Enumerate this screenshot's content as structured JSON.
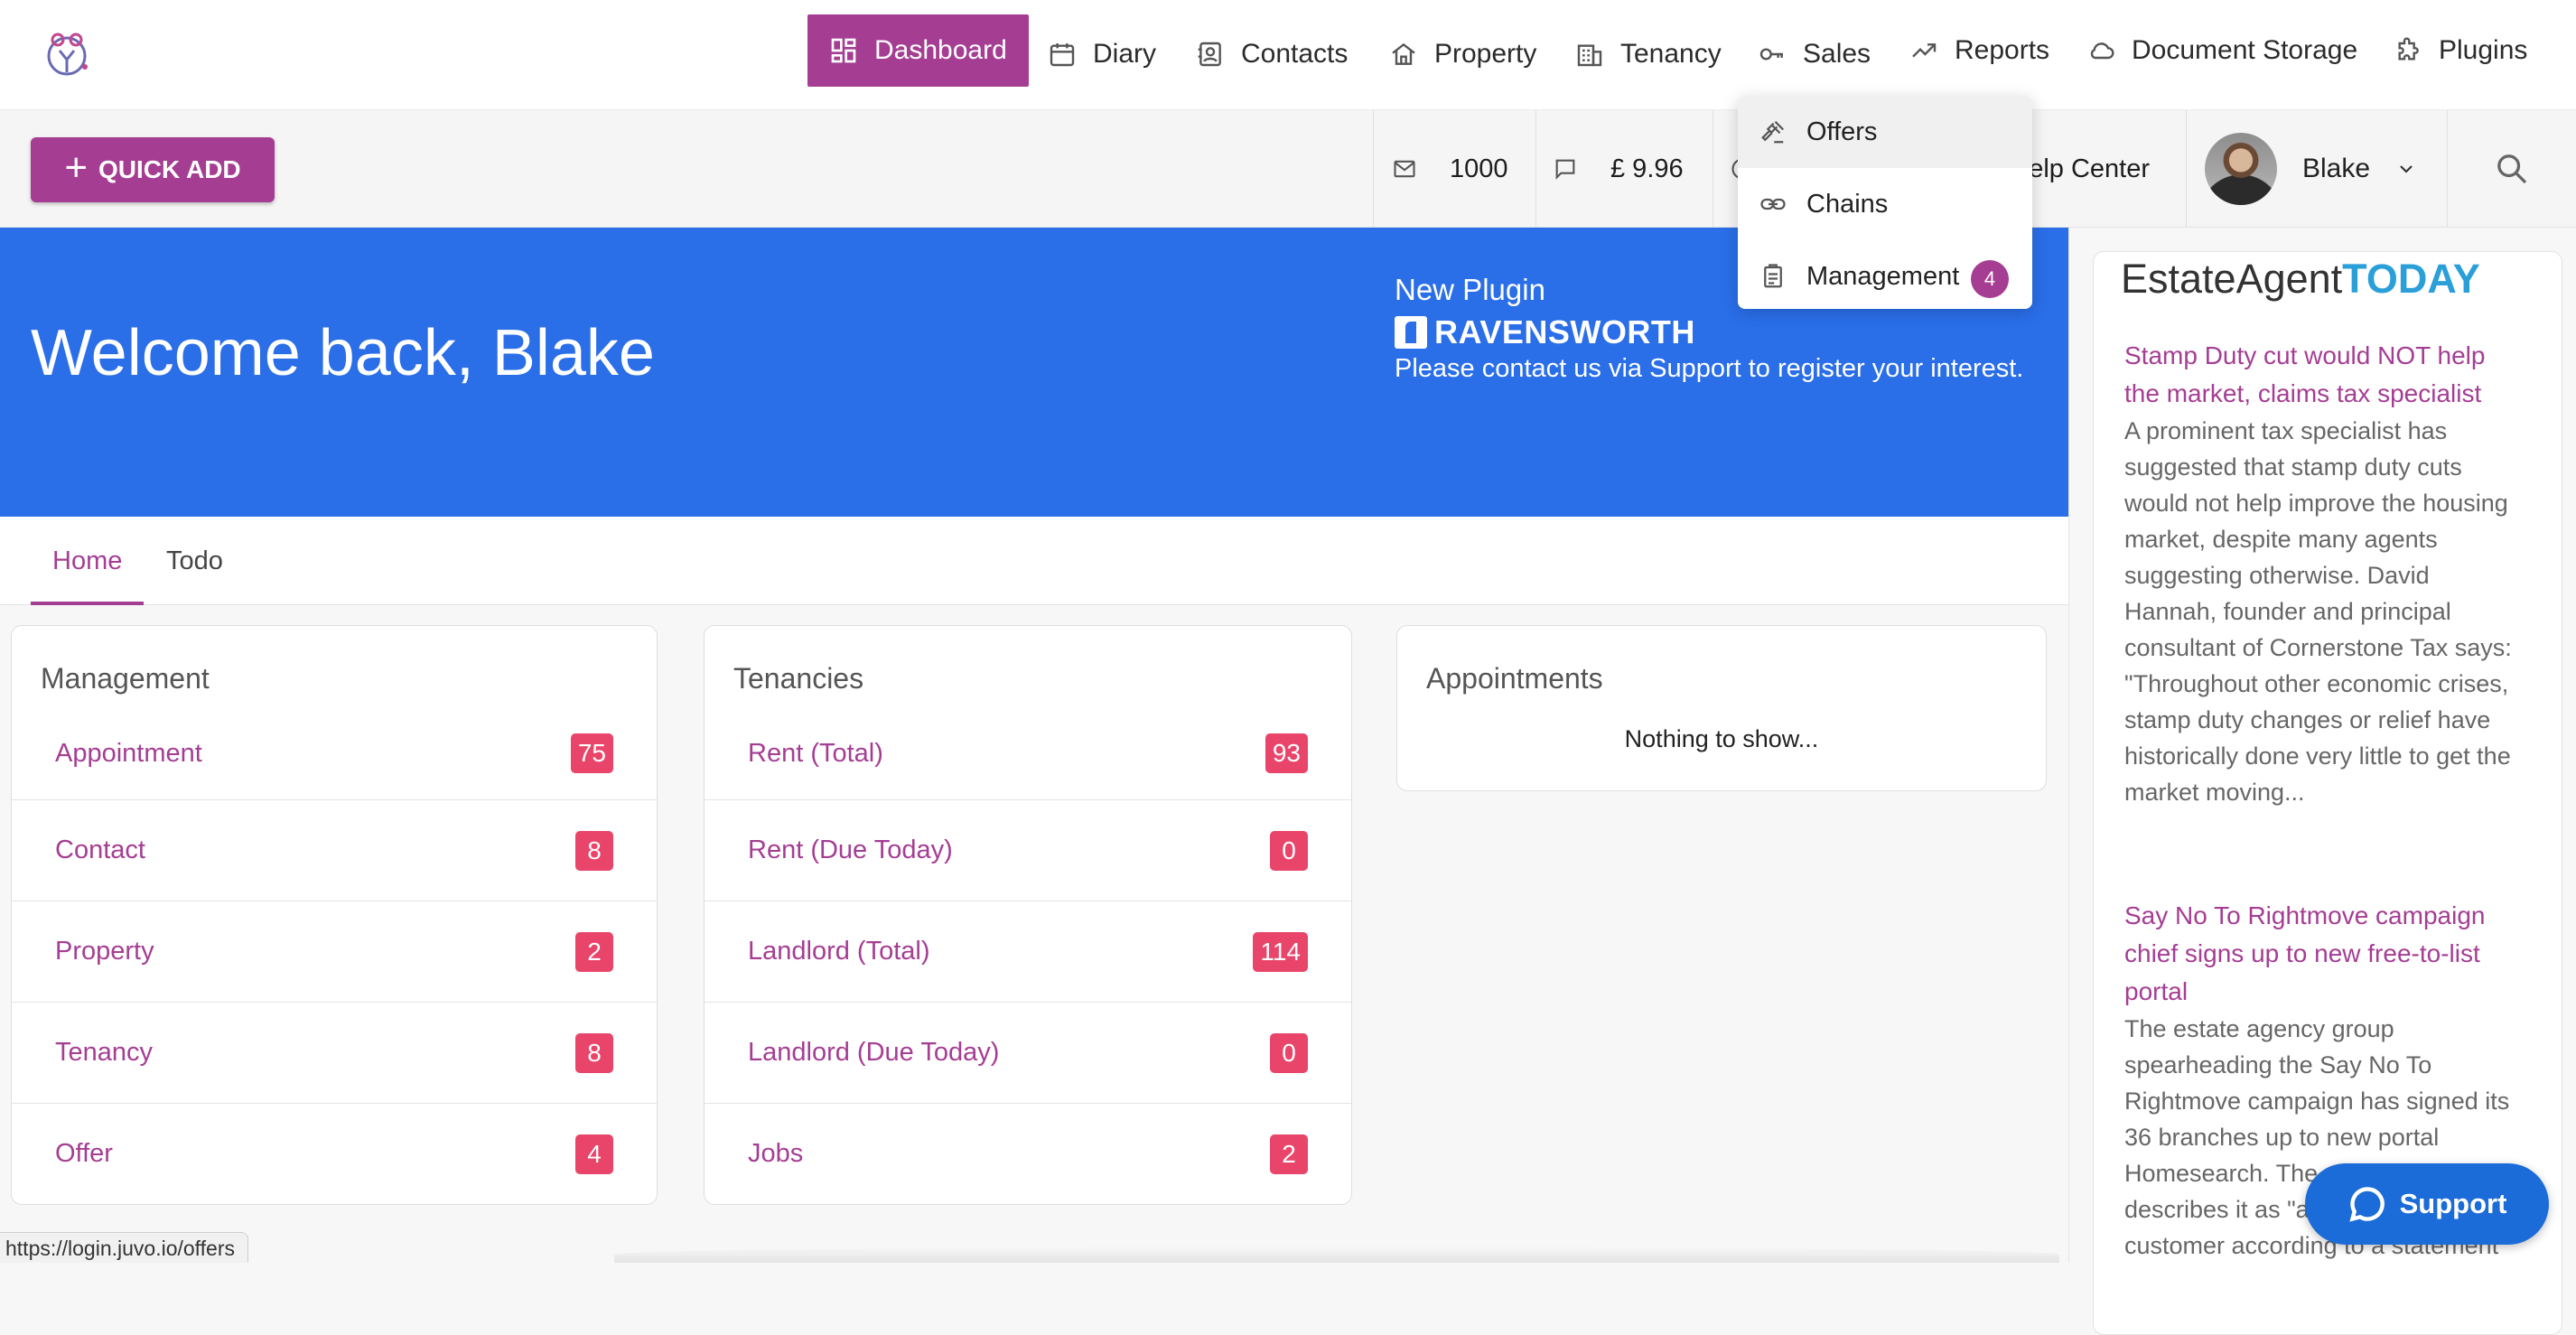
{
  "topnav": {
    "items": [
      {
        "label": "Dashboard",
        "icon": "dashboard-icon",
        "active": true
      },
      {
        "label": "Diary",
        "icon": "calendar-icon"
      },
      {
        "label": "Contacts",
        "icon": "contacts-icon"
      },
      {
        "label": "Property",
        "icon": "home-icon"
      },
      {
        "label": "Tenancy",
        "icon": "building-icon"
      },
      {
        "label": "Sales",
        "icon": "key-icon"
      },
      {
        "label": "Reports",
        "icon": "trending-up-icon"
      },
      {
        "label": "Document Storage",
        "icon": "cloud-icon"
      },
      {
        "label": "Plugins",
        "icon": "puzzle-icon"
      }
    ]
  },
  "subbar": {
    "quick_add_label": "QUICK ADD",
    "sms_credits": "1000",
    "balance": "£ 9.96",
    "help_label": "Help Center",
    "user_name": "Blake"
  },
  "sales_menu": {
    "items": [
      {
        "label": "Offers",
        "icon": "gavel-icon"
      },
      {
        "label": "Chains",
        "icon": "link-icon"
      },
      {
        "label": "Management",
        "icon": "clipboard-icon",
        "badge": "4"
      }
    ]
  },
  "banner": {
    "welcome": "Welcome back, Blake",
    "plugin_title": "New Plugin",
    "plugin_logo_text": "RAVENSWORTH",
    "plugin_text": "Please contact us via Support to register your interest."
  },
  "tabs": [
    "Home",
    "Todo"
  ],
  "cards": {
    "management": {
      "title": "Management",
      "rows": [
        {
          "label": "Appointment",
          "count": "75"
        },
        {
          "label": "Contact",
          "count": "8"
        },
        {
          "label": "Property",
          "count": "2"
        },
        {
          "label": "Tenancy",
          "count": "8"
        },
        {
          "label": "Offer",
          "count": "4"
        }
      ]
    },
    "tenancies": {
      "title": "Tenancies",
      "rows": [
        {
          "label": "Rent (Total)",
          "count": "93"
        },
        {
          "label": "Rent (Due Today)",
          "count": "0"
        },
        {
          "label": "Landlord (Total)",
          "count": "114"
        },
        {
          "label": "Landlord (Due Today)",
          "count": "0"
        },
        {
          "label": "Jobs",
          "count": "2"
        }
      ]
    },
    "appointments": {
      "title": "Appointments",
      "empty": "Nothing to show..."
    }
  },
  "news": {
    "logo_main": "EstateAgent",
    "logo_accent": "TODAY",
    "items": [
      {
        "title": "Stamp Duty cut would NOT help the market, claims tax specialist",
        "body": "A prominent tax specialist has suggested that stamp duty cuts would not help improve the housing market, despite many agents suggesting otherwise. David Hannah, founder and principal consultant of Cornerstone Tax says: \"Throughout other economic crises, stamp duty changes or relief have historically done very little to get the market moving..."
      },
      {
        "title": "Say No To Rightmove campaign chief signs up to new free-to-list portal",
        "body": "The estate agency group spearheading the Say No To Rightmove campaign has signed its 36 branches up to new portal Homesearch. The company describes it as \"a fully subscribed customer according to a statement"
      }
    ]
  },
  "support_label": "Support",
  "status_url": "https://login.juvo.io/offers",
  "colors": {
    "accent": "#a53d93",
    "banner": "#2a6ee8",
    "badge": "#e9456a",
    "support": "#1b6bd8"
  }
}
